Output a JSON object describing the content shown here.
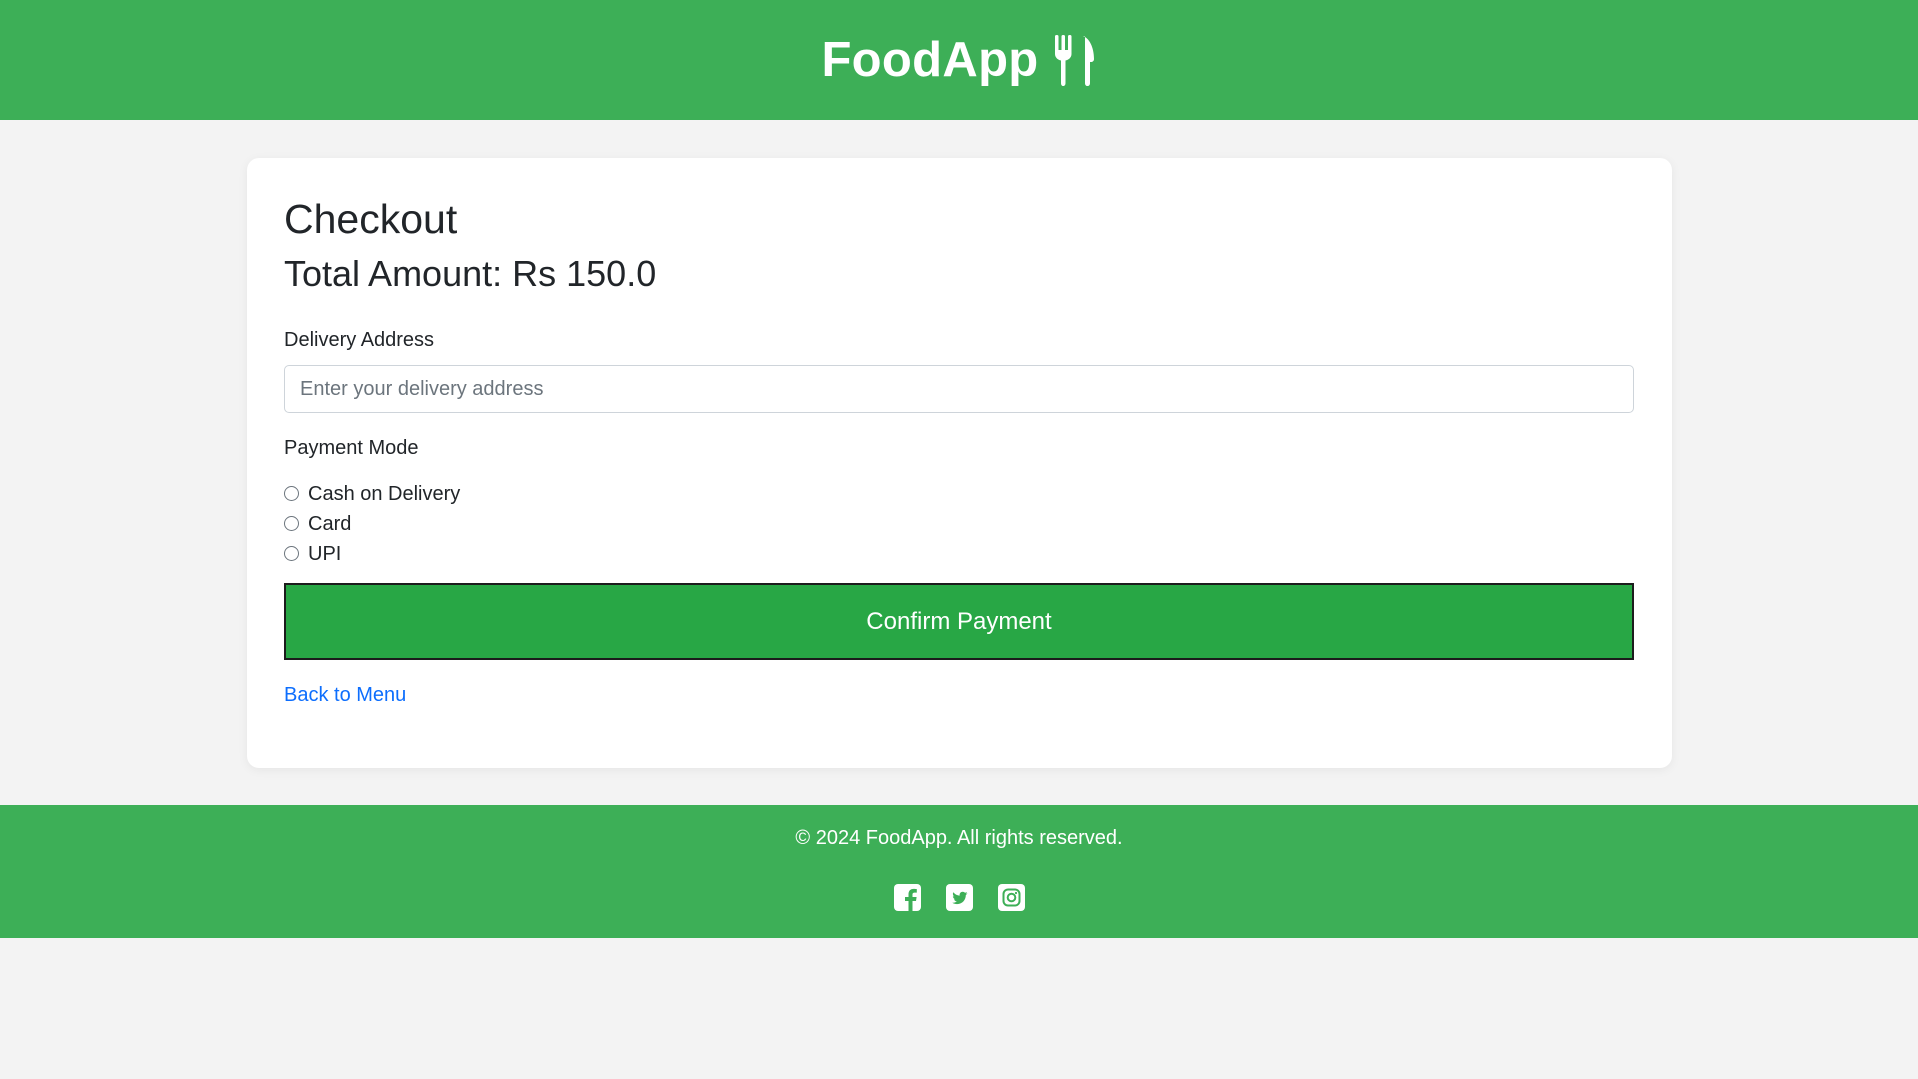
{
  "header": {
    "brand": "FoodApp",
    "brand_icon": "utensils-icon",
    "background": "#3daf57"
  },
  "checkout": {
    "title": "Checkout",
    "total_label": "Total Amount: Rs 150.0",
    "address": {
      "label": "Delivery Address",
      "value": "",
      "placeholder": "Enter your delivery address"
    },
    "payment": {
      "label": "Payment Mode",
      "options": [
        "Cash on Delivery",
        "Card",
        "UPI"
      ],
      "selected": null
    },
    "confirm_label": "Confirm Payment",
    "confirm_color": "#28a745",
    "back_link": "Back to Menu",
    "link_color": "#0d6efd"
  },
  "footer": {
    "copyright": "© 2024 FoodApp. All rights reserved.",
    "socials": [
      "facebook-icon",
      "twitter-icon",
      "instagram-icon"
    ]
  }
}
